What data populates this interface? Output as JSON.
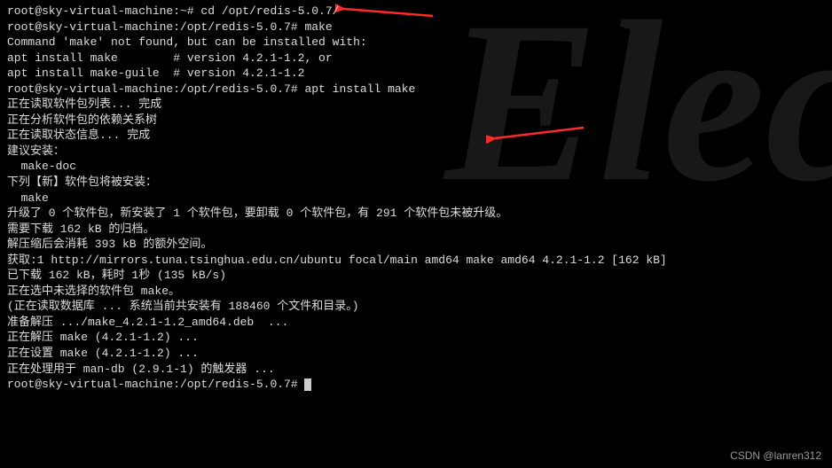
{
  "lines": {
    "l0": "root@sky-virtual-machine:~# cd /opt/redis-5.0.7/",
    "l1": "root@sky-virtual-machine:/opt/redis-5.0.7# make",
    "l2": "",
    "l3": "Command 'make' not found, but can be installed with:",
    "l4": "",
    "l5": "apt install make        # version 4.2.1-1.2, or",
    "l6": "apt install make-guile  # version 4.2.1-1.2",
    "l7": "",
    "l8": "root@sky-virtual-machine:/opt/redis-5.0.7# apt install make",
    "l9": "正在读取软件包列表... 完成",
    "l10": "正在分析软件包的依赖关系树",
    "l11": "正在读取状态信息... 完成",
    "l12": "建议安装：",
    "l13": "  make-doc",
    "l14": "下列【新】软件包将被安装：",
    "l15": "  make",
    "l16": "升级了 0 个软件包，新安装了 1 个软件包，要卸载 0 个软件包，有 291 个软件包未被升级。",
    "l17": "需要下载 162 kB 的归档。",
    "l18": "解压缩后会消耗 393 kB 的额外空间。",
    "l19": "获取:1 http://mirrors.tuna.tsinghua.edu.cn/ubuntu focal/main amd64 make amd64 4.2.1-1.2 [162 kB]",
    "l20": "已下载 162 kB，耗时 1秒 (135 kB/s)",
    "l21": "正在选中未选择的软件包 make。",
    "l22": "(正在读取数据库 ... 系统当前共安装有 188460 个文件和目录。)",
    "l23": "准备解压 .../make_4.2.1-1.2_amd64.deb  ...",
    "l24": "正在解压 make (4.2.1-1.2) ...",
    "l25": "正在设置 make (4.2.1-1.2) ...",
    "l26": "正在处理用于 man-db (2.9.1-1) 的触发器 ...",
    "l27": "root@sky-virtual-machine:/opt/redis-5.0.7# "
  },
  "watermark": "CSDN @lanren312",
  "bg_text": "Elec",
  "annotations": {
    "arrow1_color": "#ff2a2a",
    "arrow2_color": "#ff2a2a"
  }
}
